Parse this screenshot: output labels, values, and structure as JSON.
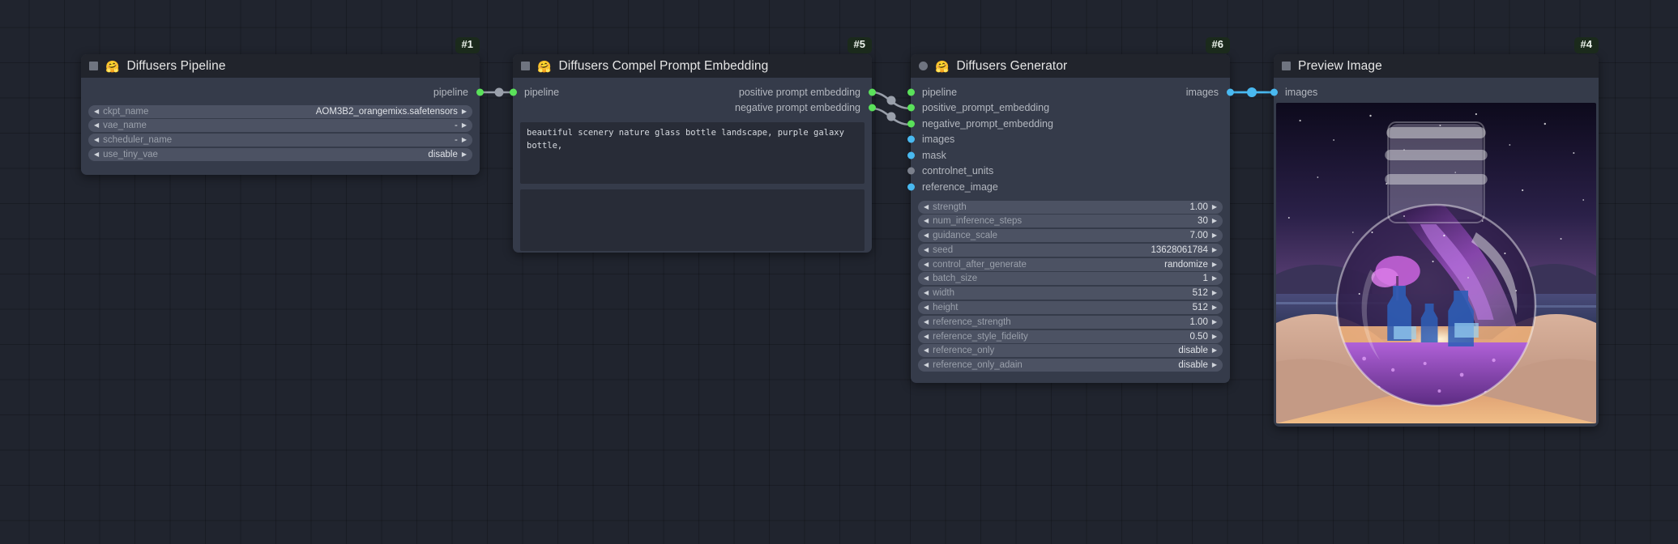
{
  "canvas": {
    "background": "#20242e",
    "grid_color": "#1b1e26"
  },
  "colors": {
    "node_body": "#353b4a",
    "node_title": "#21242c",
    "slot_green": "#5ae15a",
    "slot_blue": "#49b9f0",
    "slot_grey": "#7b808c",
    "link_grey": "#9aa0ab",
    "link_blue": "#49b9f0",
    "badge_bg": "#1b2a1c"
  },
  "nodes": [
    {
      "id": "#1",
      "title": "Diffusers Pipeline",
      "emoji": "🤗",
      "collapse_shape": "square",
      "outputs": [
        {
          "label": "pipeline",
          "color": "green"
        }
      ],
      "widgets": [
        {
          "name": "ckpt_name",
          "value": "AOM3B2_orangemixs.safetensors"
        },
        {
          "name": "vae_name",
          "value": "-"
        },
        {
          "name": "scheduler_name",
          "value": "-"
        },
        {
          "name": "use_tiny_vae",
          "value": "disable"
        }
      ]
    },
    {
      "id": "#5",
      "title": "Diffusers Compel Prompt Embedding",
      "emoji": "🤗",
      "collapse_shape": "square",
      "inputs": [
        {
          "label": "pipeline",
          "color": "green"
        }
      ],
      "outputs": [
        {
          "label": "positive prompt embedding",
          "color": "green"
        },
        {
          "label": "negative prompt embedding",
          "color": "green"
        }
      ],
      "textareas": [
        {
          "name": "positive-prompt",
          "value": "beautiful scenery nature glass bottle landscape, purple galaxy bottle,"
        },
        {
          "name": "negative-prompt",
          "value": ""
        }
      ]
    },
    {
      "id": "#6",
      "title": "Diffusers Generator",
      "emoji": "🤗",
      "collapse_shape": "circle",
      "inputs": [
        {
          "label": "pipeline",
          "color": "green"
        },
        {
          "label": "positive_prompt_embedding",
          "color": "green"
        },
        {
          "label": "negative_prompt_embedding",
          "color": "green"
        },
        {
          "label": "images",
          "color": "blue"
        },
        {
          "label": "mask",
          "color": "blue"
        },
        {
          "label": "controlnet_units",
          "color": "grey"
        },
        {
          "label": "reference_image",
          "color": "blue"
        }
      ],
      "outputs": [
        {
          "label": "images",
          "color": "blue"
        }
      ],
      "widgets": [
        {
          "name": "strength",
          "value": "1.00"
        },
        {
          "name": "num_inference_steps",
          "value": "30"
        },
        {
          "name": "guidance_scale",
          "value": "7.00"
        },
        {
          "name": "seed",
          "value": "13628061784"
        },
        {
          "name": "control_after_generate",
          "value": "randomize"
        },
        {
          "name": "batch_size",
          "value": "1"
        },
        {
          "name": "width",
          "value": "512"
        },
        {
          "name": "height",
          "value": "512"
        },
        {
          "name": "reference_strength",
          "value": "1.00"
        },
        {
          "name": "reference_style_fidelity",
          "value": "0.50"
        },
        {
          "name": "reference_only",
          "value": "disable"
        },
        {
          "name": "reference_only_adain",
          "value": "disable"
        }
      ]
    },
    {
      "id": "#4",
      "title": "Preview Image",
      "emoji": "",
      "collapse_shape": "square",
      "inputs": [
        {
          "label": "images",
          "color": "blue"
        }
      ],
      "preview_alt": "purple galaxy in a glass bottle held in hands, lavender field and lake at dusk"
    }
  ]
}
